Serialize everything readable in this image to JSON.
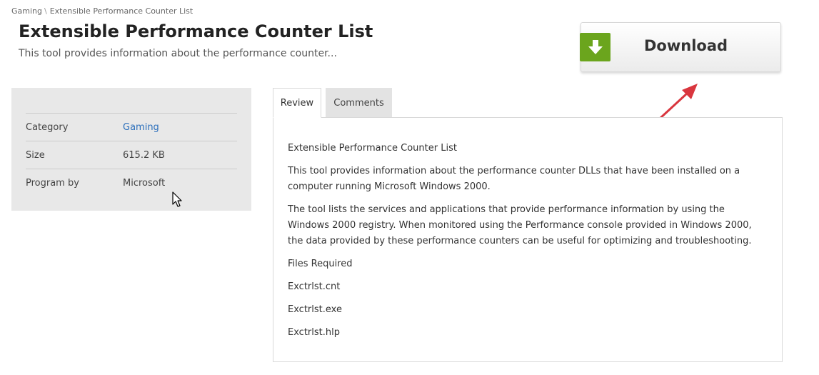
{
  "breadcrumb": {
    "parent": "Gaming",
    "separator": "\\",
    "current": "Extensible Performance Counter List"
  },
  "header": {
    "title": "Extensible Performance Counter List",
    "subtitle": "This tool provides information about the performance counter..."
  },
  "download": {
    "label": "Download",
    "icon": "download-arrow-icon",
    "icon_color": "#6ba51d"
  },
  "annotation": {
    "arrow_color": "#d9363e"
  },
  "info": {
    "rows": [
      {
        "label": "Category",
        "value": "Gaming"
      },
      {
        "label": "Size",
        "value": "615.2 KB"
      },
      {
        "label": "Program by",
        "value": "Microsoft"
      }
    ],
    "link_color": "#2a6ebb"
  },
  "tabs": {
    "review": "Review",
    "comments": "Comments",
    "active": "Review"
  },
  "review": {
    "paragraphs": [
      "Extensible Performance Counter List",
      "This tool provides information about the performance counter DLLs that have been installed on a computer running Microsoft Windows 2000.",
      "The tool lists the services and applications that provide performance information by using the Windows 2000 registry. When monitored using the Performance console provided in Windows 2000, the data provided by these performance counters can be useful for optimizing and troubleshooting.",
      "Files Required",
      "Exctrlst.cnt",
      "Exctrlst.exe",
      "Exctrlst.hlp"
    ]
  }
}
